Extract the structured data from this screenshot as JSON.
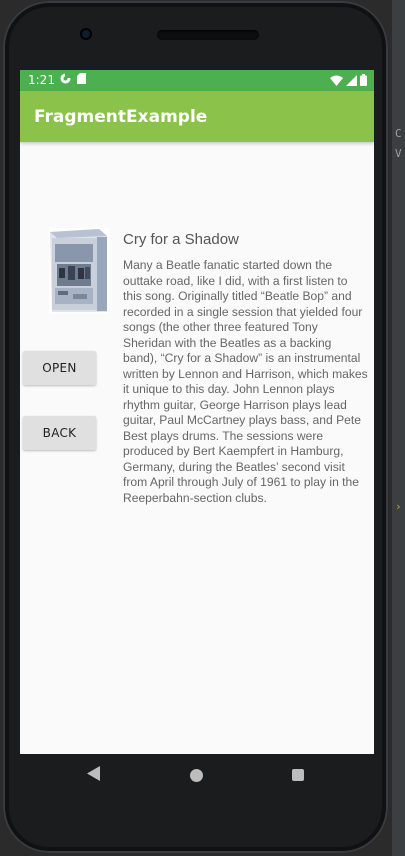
{
  "status_bar": {
    "time": "1:21",
    "left_icons": [
      "sync-icon",
      "sd-card-icon"
    ],
    "right_icons": [
      "wifi-icon",
      "signal-icon",
      "battery-icon"
    ]
  },
  "app_bar": {
    "title": "FragmentExample"
  },
  "buttons": {
    "open_label": "OPEN",
    "back_label": "BACK"
  },
  "song": {
    "title": "Cry for a Shadow",
    "description": "Many a Beatle fanatic started down the outtake road, like I did, with a first listen to this song. Originally titled “Beatle Bop” and recorded in a single session that yielded four songs (the other three featured Tony Sheridan with the Beatles as a backing band), “Cry for a Shadow” is an instrumental written by Lennon and Harrison, which makes it unique to this day. John Lennon plays rhythm guitar, George Harrison plays lead guitar, Paul McCartney plays bass, and Pete Best plays drums. The sessions were produced by Bert Kaempfert in Hamburg, Germany, during the Beatles’ second visit from April through July of 1961 to play in the Reeperbahn-section clubs."
  },
  "nav_bar": {
    "icons": [
      "back-triangle-icon",
      "home-circle-icon",
      "recents-square-icon"
    ]
  },
  "colors": {
    "status_bar": "#4caf50",
    "app_bar": "#8bc34a",
    "screen_bg": "#fafafa",
    "button_bg": "#e0e0e0"
  }
}
